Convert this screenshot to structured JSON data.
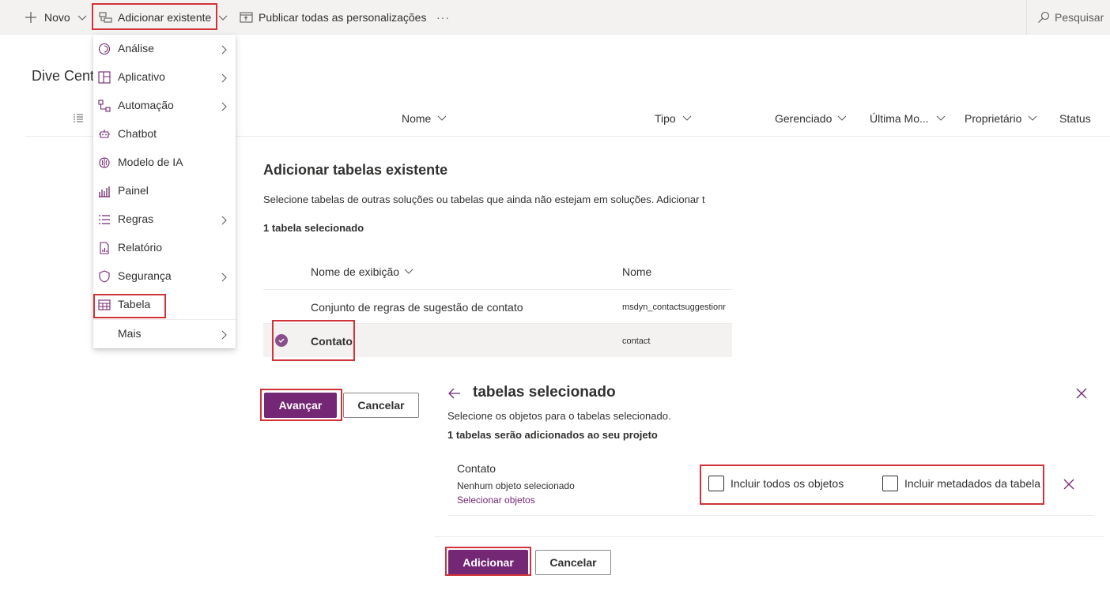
{
  "command_bar": {
    "new_label": "Novo",
    "add_existing_label": "Adicionar existente",
    "publish_label": "Publicar todas as personalizações",
    "more_label": "···",
    "search_label": "Pesquisar"
  },
  "page": {
    "title_partial": "Dive Cent"
  },
  "grid": {
    "columns": [
      "Nome",
      "Tipo",
      "Gerenciado",
      "Última Mo...",
      "Proprietário",
      "Status"
    ]
  },
  "menu": {
    "items": [
      {
        "label": "Análise",
        "icon": "analytics-icon",
        "has_submenu": true
      },
      {
        "label": "Aplicativo",
        "icon": "app-icon",
        "has_submenu": true
      },
      {
        "label": "Automação",
        "icon": "automation-icon",
        "has_submenu": true
      },
      {
        "label": "Chatbot",
        "icon": "chatbot-icon",
        "has_submenu": false
      },
      {
        "label": "Modelo de IA",
        "icon": "ai-model-icon",
        "has_submenu": false
      },
      {
        "label": "Painel",
        "icon": "dashboard-icon",
        "has_submenu": false
      },
      {
        "label": "Regras",
        "icon": "rules-icon",
        "has_submenu": true
      },
      {
        "label": "Relatório",
        "icon": "report-icon",
        "has_submenu": false
      },
      {
        "label": "Segurança",
        "icon": "security-icon",
        "has_submenu": true
      },
      {
        "label": "Tabela",
        "icon": "table-icon",
        "has_submenu": false
      },
      {
        "label": "Mais",
        "icon": "",
        "has_submenu": true
      }
    ]
  },
  "add_tables_panel": {
    "title": "Adicionar tabelas existente",
    "description": "Selecione tabelas de outras soluções ou tabelas que ainda não estejam em soluções. Adicionar t",
    "selected_count": "1 tabela selecionado",
    "columns": {
      "display_name": "Nome de exibição",
      "name": "Nome"
    },
    "rows": [
      {
        "display_name": "Conjunto de regras de sugestão de contato",
        "name": "msdyn_contactsuggestionr",
        "selected": false
      },
      {
        "display_name": "Contato",
        "name": "contact",
        "selected": true
      }
    ],
    "next_button": "Avançar",
    "cancel_button": "Cancelar"
  },
  "selected_panel": {
    "title": "tabelas selecionado",
    "description": "Selecione os objetos para o tabelas selecionado.",
    "summary": "1 tabelas serão adicionados ao seu projeto",
    "entity": {
      "name": "Contato",
      "status": "Nenhum objeto selecionado",
      "link": "Selecionar objetos",
      "include_all_label": "Incluir todos os objetos",
      "include_all_checked": false,
      "include_metadata_label": "Incluir metadados da tabela",
      "include_metadata_checked": false
    },
    "add_button": "Adicionar",
    "cancel_button": "Cancelar"
  },
  "colors": {
    "accent": "#742774",
    "highlight_box": "#d13438",
    "command_bar_bg": "#f3f2f1"
  }
}
